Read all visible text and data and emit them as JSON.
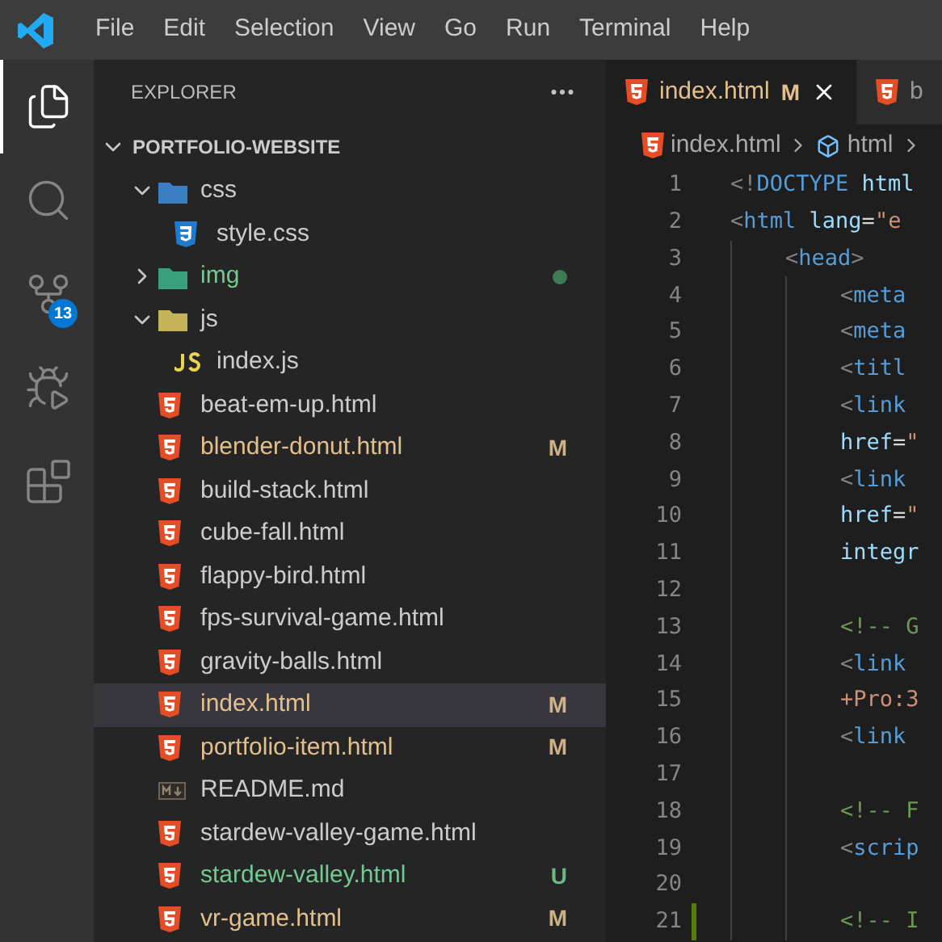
{
  "menu": [
    "File",
    "Edit",
    "Selection",
    "View",
    "Go",
    "Run",
    "Terminal",
    "Help"
  ],
  "activity_bar": [
    {
      "kind": "explorer",
      "selected": true
    },
    {
      "kind": "search",
      "selected": false
    },
    {
      "kind": "source-control",
      "selected": false,
      "badge": "13"
    },
    {
      "kind": "run-debug",
      "selected": false
    },
    {
      "kind": "extensions",
      "selected": false
    }
  ],
  "sidebar": {
    "title": "EXPLORER",
    "root": {
      "name": "PORTFOLIO-WEBSITE",
      "expanded": true,
      "children": [
        {
          "name": "css",
          "kind": "folder",
          "expanded": true,
          "children": [
            {
              "name": "style.css",
              "kind": "css"
            }
          ]
        },
        {
          "name": "img",
          "kind": "folder",
          "expanded": false,
          "color": "#73c991",
          "changes_inside": true
        },
        {
          "name": "js",
          "kind": "folder",
          "expanded": true,
          "children": [
            {
              "name": "index.js",
              "kind": "js"
            }
          ]
        },
        {
          "name": "beat-em-up.html",
          "kind": "html"
        },
        {
          "name": "blender-donut.html",
          "kind": "html",
          "color": "#e2c08d",
          "badge": "M"
        },
        {
          "name": "build-stack.html",
          "kind": "html"
        },
        {
          "name": "cube-fall.html",
          "kind": "html"
        },
        {
          "name": "flappy-bird.html",
          "kind": "html"
        },
        {
          "name": "fps-survival-game.html",
          "kind": "html"
        },
        {
          "name": "gravity-balls.html",
          "kind": "html"
        },
        {
          "name": "index.html",
          "kind": "html",
          "color": "#e2c08d",
          "badge": "M",
          "selected": true
        },
        {
          "name": "portfolio-item.html",
          "kind": "html",
          "color": "#e2c08d",
          "badge": "M"
        },
        {
          "name": "README.md",
          "kind": "md"
        },
        {
          "name": "stardew-valley-game.html",
          "kind": "html"
        },
        {
          "name": "stardew-valley.html",
          "kind": "html",
          "color": "#73c991",
          "badge": "U"
        },
        {
          "name": "vr-game.html",
          "kind": "html",
          "color": "#e2c08d",
          "badge": "M"
        }
      ]
    }
  },
  "tabs": [
    {
      "label": "index.html",
      "badge": "M",
      "selected": true
    },
    {
      "label": "b",
      "selected": false
    }
  ],
  "breadcrumb": [
    {
      "label": "index.html",
      "kind": "html"
    },
    {
      "label": "html",
      "kind": "element"
    }
  ],
  "code": [
    {
      "number": "1",
      "tokens": [
        {
          "color": "#808080",
          "t": "<!"
        },
        {
          "color": "#569cd6",
          "t": "DOCTYPE"
        },
        {
          "color": "#9cdcfe",
          "t": " html"
        }
      ]
    },
    {
      "number": "2",
      "tokens": [
        {
          "color": "#808080",
          "t": "<"
        },
        {
          "color": "#569cd6",
          "t": "html"
        },
        {
          "color": "#9cdcfe",
          "t": " lang"
        },
        {
          "color": "#d4d4d4",
          "t": "="
        },
        {
          "color": "#ce9178",
          "t": "\"e"
        }
      ],
      "children": [
        {
          "number": "3",
          "tokens": [
            {
              "color": "#808080",
              "t": "<"
            },
            {
              "color": "#569cd6",
              "t": "head"
            },
            {
              "color": "#808080",
              "t": ">"
            }
          ],
          "children": [
            {
              "number": "4",
              "tokens": [
                {
                  "color": "#808080",
                  "t": "<"
                },
                {
                  "color": "#569cd6",
                  "t": "meta"
                }
              ]
            },
            {
              "number": "5",
              "tokens": [
                {
                  "color": "#808080",
                  "t": "<"
                },
                {
                  "color": "#569cd6",
                  "t": "meta"
                }
              ]
            },
            {
              "number": "6",
              "tokens": [
                {
                  "color": "#808080",
                  "t": "<"
                },
                {
                  "color": "#569cd6",
                  "t": "titl"
                }
              ]
            },
            {
              "number": "7",
              "tokens": [
                {
                  "color": "#808080",
                  "t": "<"
                },
                {
                  "color": "#569cd6",
                  "t": "link"
                }
              ]
            },
            {
              "number": "8",
              "tokens": [
                {
                  "color": "#9cdcfe",
                  "t": "href"
                },
                {
                  "color": "#d4d4d4",
                  "t": "="
                },
                {
                  "color": "#ce9178",
                  "t": "\""
                }
              ]
            },
            {
              "number": "9",
              "tokens": [
                {
                  "color": "#808080",
                  "t": "<"
                },
                {
                  "color": "#569cd6",
                  "t": "link"
                }
              ]
            },
            {
              "number": "10",
              "tokens": [
                {
                  "color": "#9cdcfe",
                  "t": "href"
                },
                {
                  "color": "#d4d4d4",
                  "t": "="
                },
                {
                  "color": "#ce9178",
                  "t": "\""
                }
              ]
            },
            {
              "number": "11",
              "tokens": [
                {
                  "color": "#9cdcfe",
                  "t": "integr"
                }
              ]
            },
            {
              "number": "12"
            },
            {
              "number": "13",
              "tokens": [
                {
                  "color": "#6a9955",
                  "t": "<!-- G"
                }
              ]
            },
            {
              "number": "14",
              "tokens": [
                {
                  "color": "#808080",
                  "t": "<"
                },
                {
                  "color": "#569cd6",
                  "t": "link"
                }
              ]
            },
            {
              "number": "15",
              "tokens": [
                {
                  "color": "#ce9178",
                  "t": "+Pro:3"
                }
              ]
            },
            {
              "number": "16",
              "tokens": [
                {
                  "color": "#808080",
                  "t": "<"
                },
                {
                  "color": "#569cd6",
                  "t": "link"
                }
              ]
            },
            {
              "number": "17"
            },
            {
              "number": "18",
              "tokens": [
                {
                  "color": "#6a9955",
                  "t": "<!-- F"
                }
              ]
            },
            {
              "number": "19",
              "tokens": [
                {
                  "color": "#808080",
                  "t": "<"
                },
                {
                  "color": "#569cd6",
                  "t": "scrip"
                }
              ]
            },
            {
              "number": "20"
            },
            {
              "number": "21",
              "added": true,
              "tokens": [
                {
                  "color": "#6a9955",
                  "t": "<!-- I"
                }
              ]
            }
          ]
        }
      ]
    }
  ]
}
